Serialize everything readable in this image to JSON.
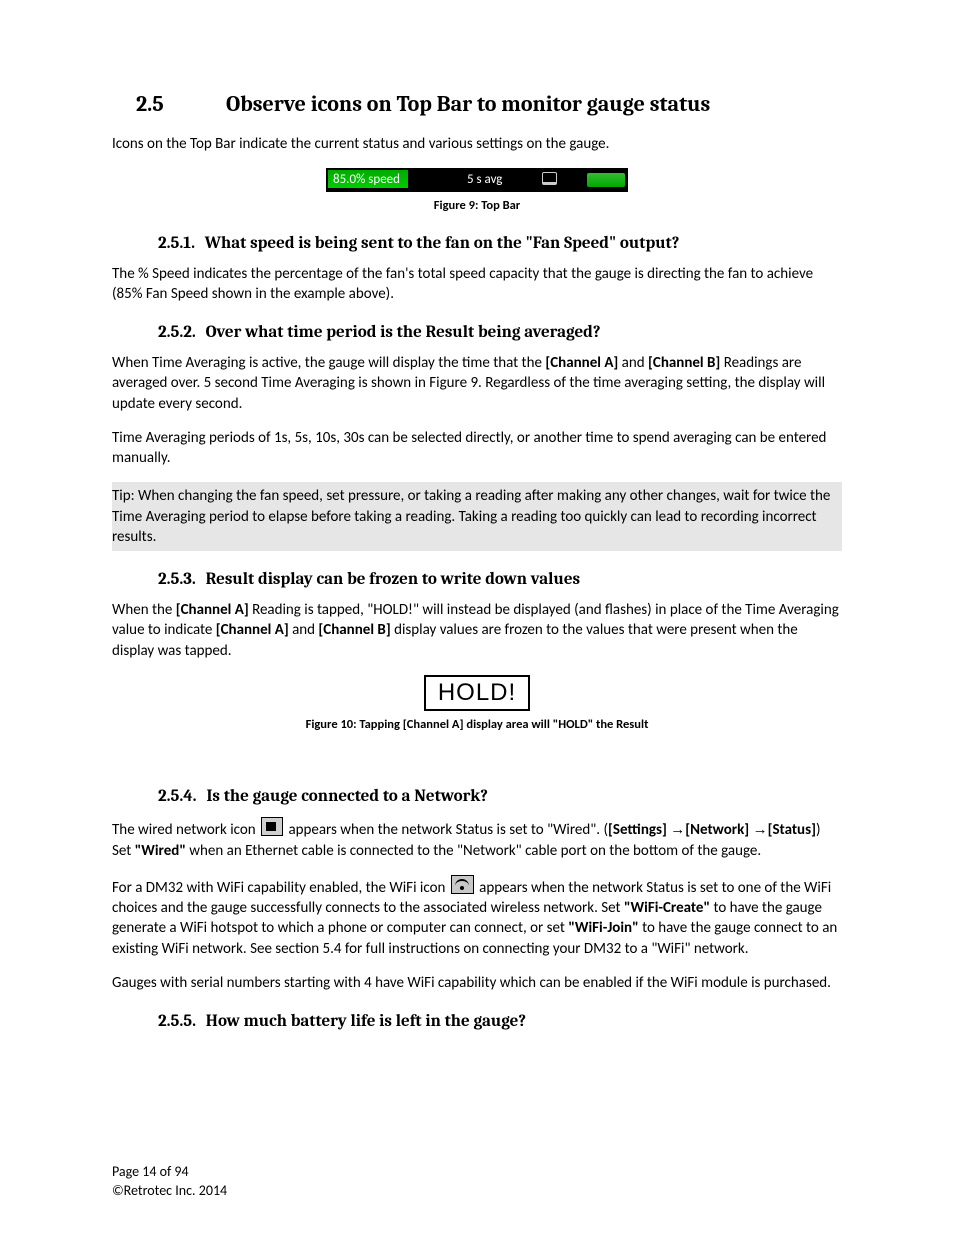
{
  "h1": {
    "num": "2.5",
    "text": "Observe icons on Top Bar to monitor gauge status"
  },
  "p_intro": "Icons on the Top Bar indicate the current status and various settings on the gauge.",
  "topbar": {
    "speed": "85.0% speed",
    "avg": "5 s avg"
  },
  "fig9": "Figure 9:  Top Bar",
  "s1": {
    "num": "2.5.1.",
    "title": "What speed is being sent to the fan on the \"Fan Speed\" output?"
  },
  "p_s1": "The % Speed indicates the percentage of the fan's total speed capacity that the gauge is directing the fan to achieve (85% Fan Speed shown in the example above).",
  "s2": {
    "num": "2.5.2.",
    "title": "Over what time period is the Result being averaged?"
  },
  "p_s2_a_pre": "When Time Averaging is active, the gauge will display the time that the ",
  "chA": "[Channel A]",
  "and": " and ",
  "chB": "[Channel B]",
  "p_s2_a_post": " Readings are averaged over.  5 second Time Averaging is shown in Figure 9.  Regardless of the time averaging setting, the display will update every second.",
  "p_s2_b": "Time Averaging periods of 1s, 5s, 10s, 30s can be selected directly, or another time to spend averaging can be entered manually.",
  "tip": "Tip:  When changing the fan speed, set pressure, or taking a reading after making any other changes, wait for twice the Time Averaging period to elapse before taking a reading.  Taking a reading too quickly can lead to recording incorrect results.",
  "s3": {
    "num": "2.5.3.",
    "title": "Result display can be frozen to write down values"
  },
  "p_s3_pre": "When the ",
  "p_s3_mid1": " Reading is tapped, \"HOLD!\" will instead be displayed (and flashes) in place of the Time Averaging value to indicate ",
  "p_s3_mid2": " and ",
  "p_s3_post": " display values are frozen to the values that were present when the display was tapped.",
  "hold": "HOLD!",
  "fig10": "Figure 10:  Tapping [Channel A] display area will \"HOLD\" the Result",
  "s4": {
    "num": "2.5.4.",
    "title": "Is the gauge connected to a Network?"
  },
  "p_s4a_1": "The wired network icon ",
  "p_s4a_2": " appears when the network Status is set to \"Wired\".  (",
  "settings": "[Settings]",
  "arrow": "→",
  "network": "[Network]",
  "status": "[Status]",
  "p_s4a_3": ")  Set ",
  "wired": "\"Wired\"",
  "p_s4a_4": " when an Ethernet cable is connected to the \"Network\" cable port on the bottom of the gauge.",
  "p_s4b_1": "For a DM32 with WiFi capability enabled, the WiFi icon ",
  "p_s4b_2": " appears when the network Status is set to one of the WiFi choices and the gauge successfully connects to the associated wireless network.  Set ",
  "wcreate": "\"WiFi-Create\"",
  "p_s4b_3": " to have the gauge generate a WiFi hotspot to which a phone or computer can connect, or set ",
  "wjoin": "\"WiFi-Join\"",
  "p_s4b_4": " to  have the gauge connect to an existing WiFi network.  See section 5.4 for full instructions on connecting your DM32 to a \"WiFi\" network.",
  "p_s4c": "Gauges with serial numbers starting with 4 have WiFi capability which can be enabled if the WiFi module is purchased.",
  "s5": {
    "num": "2.5.5.",
    "title": "How much battery life is left in the gauge?"
  },
  "footer": {
    "page": "Page 14 of 94",
    "copy": "©Retrotec Inc. 2014"
  }
}
